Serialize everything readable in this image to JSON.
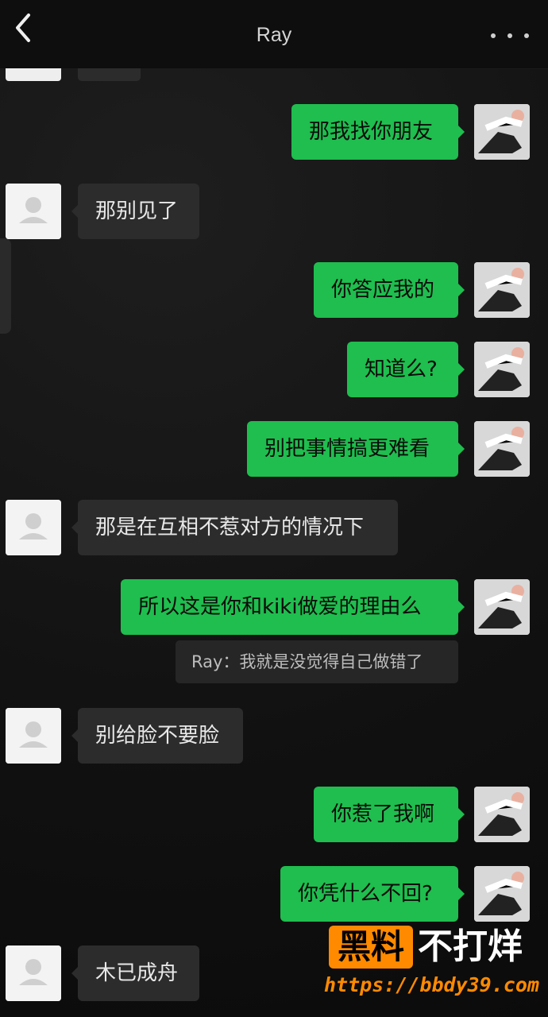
{
  "header": {
    "title": "Ray"
  },
  "messages": [
    {
      "side": "out",
      "text": "那我找你朋友"
    },
    {
      "side": "in",
      "text": "那别见了"
    },
    {
      "side": "out",
      "text": "你答应我的"
    },
    {
      "side": "out",
      "text": "知道么?"
    },
    {
      "side": "out",
      "text": "别把事情搞更难看"
    },
    {
      "side": "in",
      "text": "那是在互相不惹对方的情况下"
    },
    {
      "side": "out",
      "text": "所以这是你和kiki做爱的理由么"
    },
    {
      "side": "in",
      "text": "别给脸不要脸"
    },
    {
      "side": "out",
      "text": "你惹了我啊"
    },
    {
      "side": "out",
      "text": "你凭什么不回?"
    },
    {
      "side": "in",
      "text": "木已成舟"
    }
  ],
  "quote": {
    "text": "Ray：我就是没觉得自己做错了"
  },
  "watermark": {
    "badge": "黑料",
    "text": "不打烊",
    "url": "https://bbdy39.com"
  },
  "colors": {
    "outgoing": "#1fbe4e",
    "incoming": "#2c2c2c",
    "background": "#121212"
  }
}
